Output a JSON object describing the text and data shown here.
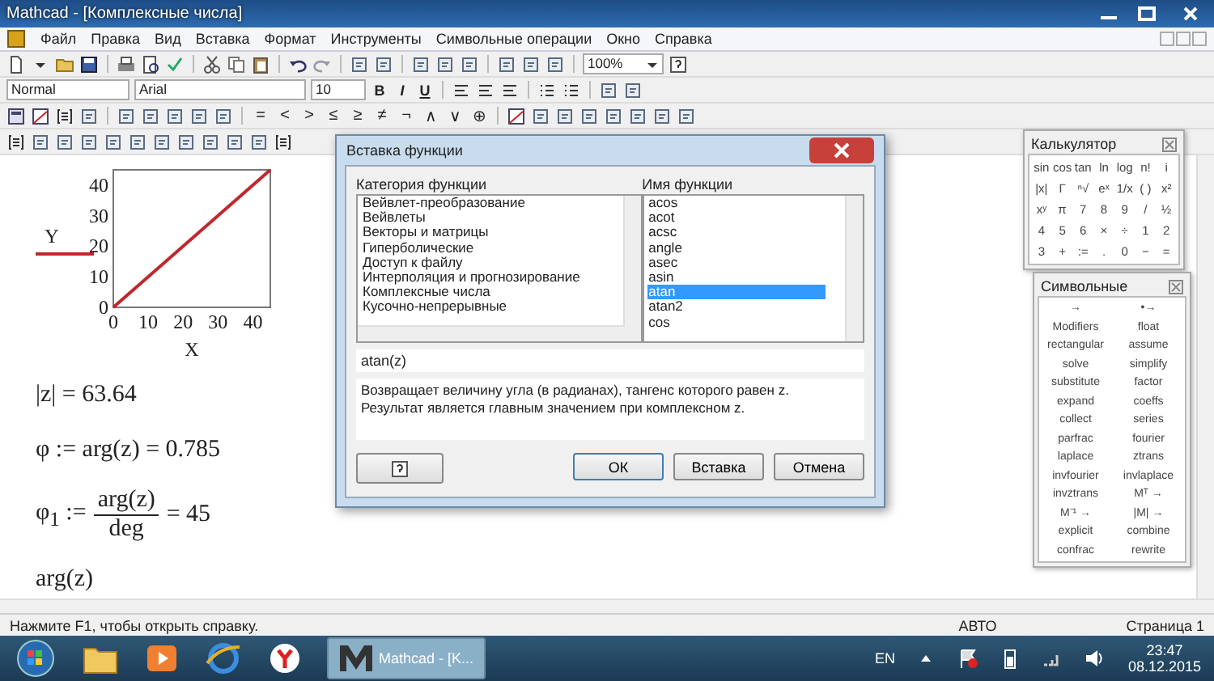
{
  "window": {
    "title": "Mathcad - [Комплексные числа]"
  },
  "menu": [
    "Файл",
    "Правка",
    "Вид",
    "Вставка",
    "Формат",
    "Инструменты",
    "Символьные операции",
    "Окно",
    "Справка"
  ],
  "toolbar": {
    "zoom": "100%"
  },
  "format_bar": {
    "style": "Normal",
    "font": "Arial",
    "size": "10",
    "buttons": [
      "B",
      "I",
      "U"
    ]
  },
  "math_bar": {
    "operators": [
      "=",
      "<",
      ">",
      "≤",
      "≥",
      "≠",
      "¬",
      "∧",
      "∨",
      "⊕"
    ]
  },
  "worksheet": {
    "chart_data": {
      "type": "line",
      "xlabel": "X",
      "x": [
        0,
        45
      ],
      "series": [
        {
          "name": "Y",
          "color": "#c0272d",
          "values": [
            0,
            45
          ]
        }
      ],
      "xlim": [
        0,
        45
      ],
      "ylim": [
        0,
        45
      ],
      "xticks": [
        0,
        10,
        20,
        30,
        40
      ],
      "yticks": [
        0,
        10,
        20,
        30,
        40
      ]
    },
    "equations": [
      {
        "kind": "plain",
        "text": "|z| = 63.64"
      },
      {
        "kind": "plain",
        "text": "φ := arg(z) = 0.785"
      },
      {
        "kind": "fraction",
        "lhs": "φ$_{1}$ :=",
        "num": "arg(z)",
        "den": "deg",
        "rhs": "= 45"
      },
      {
        "kind": "plain",
        "text": "arg(z)"
      }
    ]
  },
  "dialog": {
    "title": "Вставка функции",
    "category_label": "Категория функции",
    "categories": [
      {
        "label": "Вейвлет-преобразование",
        "selected": false
      },
      {
        "label": "Вейвлеты",
        "selected": false
      },
      {
        "label": "Векторы и матрицы",
        "selected": false
      },
      {
        "label": "Гиперболические",
        "selected": false
      },
      {
        "label": "Доступ к файлу",
        "selected": false
      },
      {
        "label": "Интерполяция и прогнозирование",
        "selected": false
      },
      {
        "label": "Комплексные числа",
        "selected": false
      },
      {
        "label": "Кусочно-непрерывные",
        "selected": false
      }
    ],
    "name_label": "Имя функции",
    "names": [
      {
        "label": "acos",
        "selected": false
      },
      {
        "label": "acot",
        "selected": false
      },
      {
        "label": "acsc",
        "selected": false
      },
      {
        "label": "angle",
        "selected": false
      },
      {
        "label": "asec",
        "selected": false
      },
      {
        "label": "asin",
        "selected": false
      },
      {
        "label": "atan",
        "selected": true
      },
      {
        "label": "atan2",
        "selected": false
      },
      {
        "label": "cos",
        "selected": false
      }
    ],
    "signature": "atan(z)",
    "description": "Возвращает величину угла (в радианах), тангенс которого равен z. Результат является главным значением при комплексном z.",
    "buttons": [
      "ОК",
      "Вставка",
      "Отмена"
    ]
  },
  "calculator": {
    "title": "Калькулятор",
    "keys": [
      "sin",
      "cos",
      "tan",
      "ln",
      "log",
      "n!",
      "i",
      "|x|",
      "Γ",
      "ⁿ√",
      "eˣ",
      "1/x",
      "( )",
      "x²",
      "xʸ",
      "π",
      "7",
      "8",
      "9",
      "/",
      "½",
      "4",
      "5",
      "6",
      "×",
      "÷",
      "1",
      "2",
      "3",
      "+",
      ":=",
      ".",
      "0",
      "−",
      "="
    ]
  },
  "symbolic": {
    "title": "Символьные",
    "keys": [
      "→",
      "•→",
      "Modifiers",
      "float",
      "rectangular",
      "assume",
      "solve",
      "simplify",
      "substitute",
      "factor",
      "expand",
      "coeffs",
      "collect",
      "series",
      "parfrac",
      "fourier",
      "laplace",
      "ztrans",
      "invfourier",
      "invlaplace",
      "invztrans",
      "Mᵀ →",
      "M⁻¹ →",
      "|M| →",
      "explicit",
      "combine",
      "confrac",
      "rewrite"
    ]
  },
  "status_bar": {
    "message": "Нажмите F1, чтобы открыть справку.",
    "mode": "АВТО",
    "page": "Страница 1"
  },
  "taskbar": {
    "window_button": {
      "label": "Mathcad - [K...",
      "selected": true
    },
    "language": "EN",
    "time": "23:47",
    "date": "08.12.2015"
  }
}
